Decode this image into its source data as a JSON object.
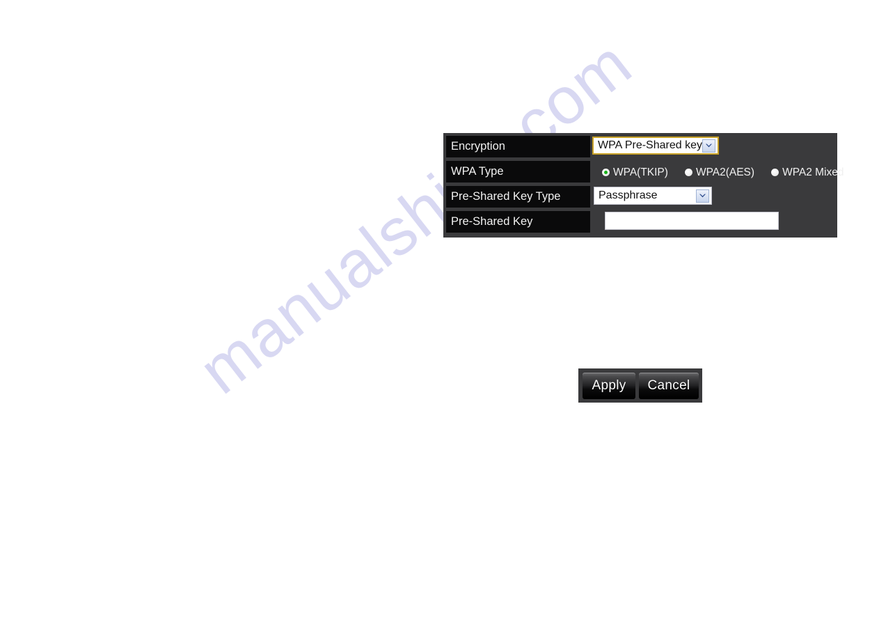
{
  "watermark": {
    "text": "manualshive.com"
  },
  "settings_panel": {
    "rows": [
      {
        "label": "Encryption",
        "control": "select",
        "value": "WPA Pre-Shared key",
        "arrow_icon": "chevron-down-icon"
      },
      {
        "label": "WPA Type",
        "control": "radio-group",
        "options": [
          {
            "label": "WPA(TKIP)",
            "selected": true
          },
          {
            "label": "WPA2(AES)",
            "selected": false
          },
          {
            "label": "WPA2 Mixed",
            "selected": false
          }
        ]
      },
      {
        "label": "Pre-Shared Key Type",
        "control": "select",
        "value": "Passphrase",
        "arrow_icon": "chevron-down-icon"
      },
      {
        "label": "Pre-Shared Key",
        "control": "text",
        "value": "",
        "placeholder": ""
      }
    ]
  },
  "buttons": {
    "apply_label": "Apply",
    "cancel_label": "Cancel"
  },
  "colors": {
    "page_background": "#ffffff",
    "panel_background": "#3a3a3c",
    "label_cell_background": "#0a0a0b",
    "label_text": "#f2f2f2",
    "focus_border": "#c9a227",
    "radio_selected": "#19b319",
    "watermark_text": "#d6d6f2"
  }
}
